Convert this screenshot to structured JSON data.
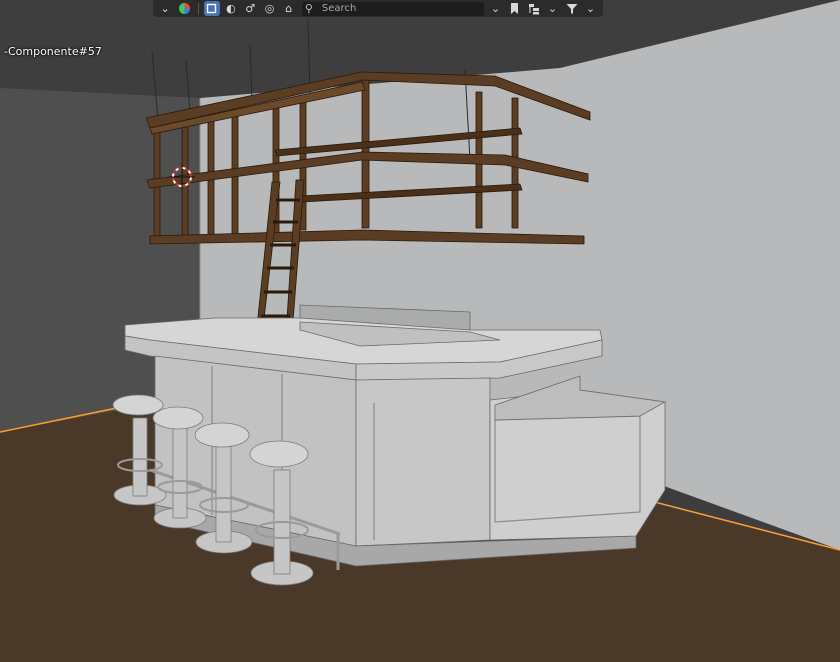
{
  "header": {
    "search_placeholder": "Search",
    "icons": [
      "chevron-down-icon",
      "color-wheel-icon",
      "restrict-select-icon",
      "object-type-icon",
      "modifier-icon",
      "link-icon",
      "camera-icon",
      "search-icon",
      "dropdown-icon",
      "bookmark-icon",
      "hierarchy-icon",
      "chevron-down-icon",
      "filter-icon",
      "chevron-down-icon"
    ]
  },
  "viewport": {
    "active_object_label": "-Componente#57",
    "colors": {
      "wall_light": "#b5b7b8",
      "wall_dark": "#4e4e4e",
      "ceiling": "#3d3d3d",
      "floor": "#4a3927",
      "wood": "#5a3d22",
      "selection_outline": "#ff9a2e",
      "bar_grey": "#c8c8c8"
    }
  }
}
